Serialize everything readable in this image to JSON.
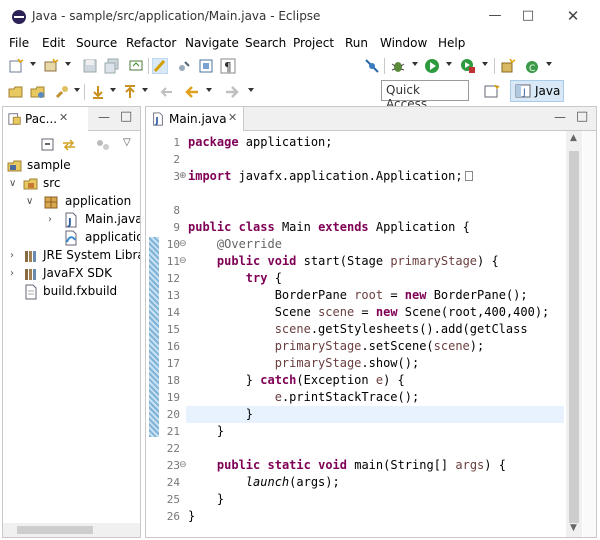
{
  "window": {
    "title": "Java - sample/src/application/Main.java - Eclipse"
  },
  "menu": [
    "File",
    "Edit",
    "Source",
    "Refactor",
    "Navigate",
    "Search",
    "Project",
    "Run",
    "Window",
    "Help"
  ],
  "toolbar": {
    "quick_access": "Quick Access",
    "perspective": "Java"
  },
  "package_explorer": {
    "tab_label": "Pac...",
    "tree": [
      {
        "label": "sample",
        "depth": 0,
        "arrow": "",
        "icon": "project-icon"
      },
      {
        "label": "src",
        "depth": 1,
        "arrow": "open",
        "icon": "source-folder-icon"
      },
      {
        "label": "application",
        "depth": 2,
        "arrow": "open",
        "icon": "package-icon"
      },
      {
        "label": "Main.java",
        "depth": 3,
        "arrow": "closed",
        "icon": "java-file-icon"
      },
      {
        "label": "application.css",
        "depth": 3,
        "arrow": "",
        "icon": "css-file-icon"
      },
      {
        "label": "JRE System Library",
        "depth": 1,
        "arrow": "closed",
        "icon": "library-icon"
      },
      {
        "label": "JavaFX SDK",
        "depth": 1,
        "arrow": "closed",
        "icon": "library-icon"
      },
      {
        "label": "build.fxbuild",
        "depth": 1,
        "arrow": "",
        "icon": "file-icon"
      }
    ]
  },
  "editor": {
    "tab_label": "Main.java",
    "line_numbers": [
      "1",
      "2",
      "3",
      "8",
      "9",
      "10",
      "11",
      "12",
      "13",
      "14",
      "15",
      "16",
      "17",
      "18",
      "19",
      "20",
      "21",
      "22",
      "23",
      "24",
      "25",
      "26"
    ],
    "code": {
      "l1_kw": "package",
      "l1_rest": " application;",
      "l3_kw": "import",
      "l3_rest": " javafx.application.Application;",
      "l9_kw1": "public",
      "l9_kw2": "class",
      "l9_name": " Main ",
      "l9_kw3": "extends",
      "l9_rest": " Application {",
      "l10_ann": "@Override",
      "l11_kw1": "public",
      "l11_kw2": "void",
      "l11_mid": " start(Stage ",
      "l11_var": "primaryStage",
      "l11_rest": ") {",
      "l12_kw": "try",
      "l12_rest": " {",
      "l13_a": "BorderPane ",
      "l13_var": "root",
      "l13_b": " = ",
      "l13_kw": "new",
      "l13_c": " BorderPane();",
      "l14_a": "Scene ",
      "l14_var": "scene",
      "l14_b": " = ",
      "l14_kw": "new",
      "l14_c": " Scene(root,400,400);",
      "l15_var": "scene",
      "l15_rest": ".getStylesheets().add(getClass",
      "l16_var1": "primaryStage",
      "l16_mid": ".setScene(",
      "l16_var2": "scene",
      "l16_rest": ");",
      "l17_var": "primaryStage",
      "l17_rest": ".show();",
      "l18_a": "} ",
      "l18_kw": "catch",
      "l18_b": "(Exception ",
      "l18_var": "e",
      "l18_c": ") {",
      "l19_var": "e",
      "l19_rest": ".printStackTrace();",
      "l20": "}",
      "l21": "}",
      "l23_kw1": "public",
      "l23_kw2": "static",
      "l23_kw3": "void",
      "l23_mid": " main(String[] ",
      "l23_var": "args",
      "l23_rest": ") {",
      "l24_it": "launch",
      "l24_rest": "(args);",
      "l25": "}",
      "l26": "}"
    }
  },
  "colors": {
    "keyword": "#7f0055",
    "annotation": "#646464",
    "variable": "#6a3e3e",
    "line_number": "#787878",
    "selection": "#e8f2fe"
  }
}
